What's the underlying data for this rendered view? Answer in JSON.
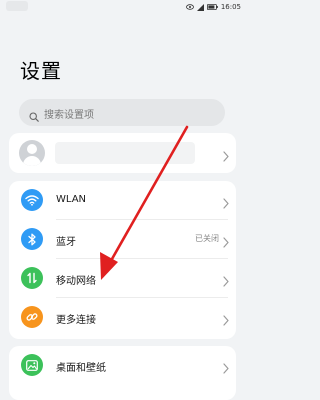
{
  "status_bar": {
    "time": "16:05"
  },
  "page": {
    "title": "设置"
  },
  "search": {
    "placeholder": "搜索设置项"
  },
  "settings": {
    "items": [
      {
        "label": "WLAN",
        "value": "",
        "icon": "wifi-icon",
        "color": "#2f9bf5"
      },
      {
        "label": "蓝牙",
        "value": "已关闭",
        "icon": "bluetooth-icon",
        "color": "#2f9bf5"
      },
      {
        "label": "移动网络",
        "value": "",
        "icon": "mobile-network-icon",
        "color": "#3cc15a"
      },
      {
        "label": "更多连接",
        "value": "",
        "icon": "link-icon",
        "color": "#f7941d"
      }
    ]
  },
  "display": {
    "items": [
      {
        "label": "桌面和壁纸",
        "icon": "wallpaper-icon",
        "color": "#3cc15a"
      }
    ]
  },
  "annotation": {
    "arrow_color": "#e02020"
  }
}
